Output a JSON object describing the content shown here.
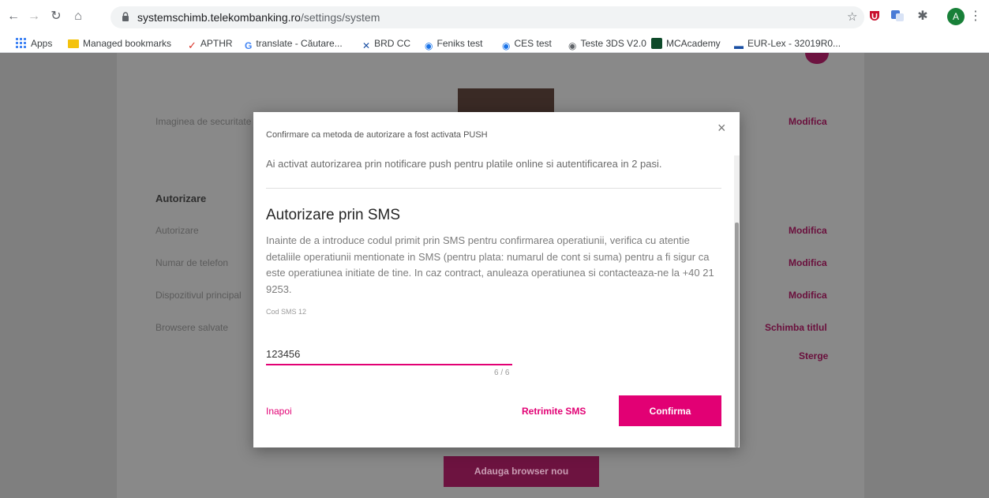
{
  "browser": {
    "url_host": "systemschimb.telekombanking.ro",
    "url_path": "/settings/system",
    "avatar_letter": "A",
    "bookmarks": [
      "Apps",
      "Managed bookmarks",
      "APTHR",
      "translate - Căutare...",
      "BRD CC",
      "Feniks test",
      "CES test",
      "Teste 3DS V2.0",
      "MCAcademy",
      "EUR-Lex - 32019R0..."
    ]
  },
  "background": {
    "security_image_label": "Imaginea de securitate",
    "security_image_action": "Modifica",
    "authorization_section": "Autorizare",
    "rows": [
      {
        "label": "Autorizare",
        "action": "Modifica"
      },
      {
        "label": "Numar de telefon",
        "action": "Modifica"
      },
      {
        "label": "Dispozitivul principal",
        "action": "Modifica"
      },
      {
        "label": "Browsere salvate",
        "action": "Schimba titlul"
      }
    ],
    "delete_action": "Sterge",
    "add_browser_button": "Adauga browser nou"
  },
  "modal": {
    "title": "Confirmare ca metoda de autorizare a fost activata PUSH",
    "info": "Ai activat autorizarea prin notificare push pentru platile online si autentificarea in 2 pasi.",
    "heading": "Autorizare prin SMS",
    "description": "Inainte de a introduce codul primit prin SMS pentru confirmarea operatiunii, verifica cu atentie detaliile operatiunii mentionate in SMS (pentru plata: numarul de cont si suma) pentru a fi sigur ca este operatiunea initiate de tine. In caz contract, anuleaza operatiunea si contacteaza-ne la +40 21 9253.",
    "field_label": "Cod SMS 12",
    "field_value": "123456",
    "counter": "6 / 6",
    "back_label": "Inapoi",
    "resend_label": "Retrimite SMS",
    "confirm_label": "Confirma",
    "close_symbol": "×"
  },
  "colors": {
    "accent": "#e20074"
  }
}
